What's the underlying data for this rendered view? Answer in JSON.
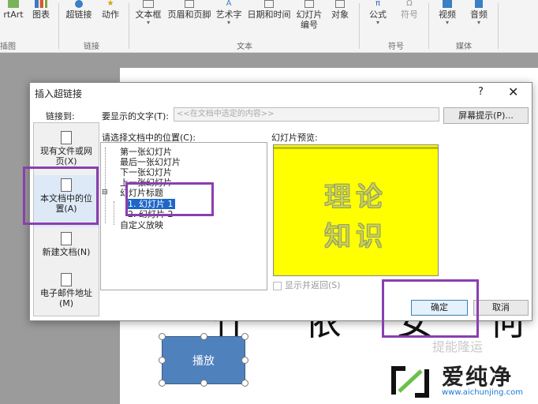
{
  "ribbon": {
    "buttons": {
      "smartart": "rtArt",
      "chart": "图表",
      "hyperlink": "超链接",
      "action": "动作",
      "textbox": "文本框",
      "header_footer": "页眉和页脚",
      "wordart": "艺术字",
      "datetime": "日期和时间",
      "slide_number_1": "幻灯片",
      "slide_number_2": "编号",
      "object": "对象",
      "equation": "公式",
      "symbol": "符号",
      "video": "视频",
      "audio": "音频"
    },
    "groups": {
      "illustrations": "插图",
      "links": "链接",
      "text": "文本",
      "symbols": "符号",
      "media": "媒体"
    }
  },
  "dialog": {
    "title": "插入超链接",
    "help": "?",
    "close": "✕",
    "link_to_label": "链接到:",
    "display_text_label": "要显示的文字(T):",
    "display_text_value": "<<在文档中选定的内容>>",
    "screentip_button": "屏幕提示(P)...",
    "link_bar": {
      "existing_file_1": "现有文件或网",
      "existing_file_2": "页(X)",
      "this_doc_1": "本文档中的位",
      "this_doc_2": "置(A)",
      "new_doc": "新建文档(N)",
      "email_1": "电子邮件地址",
      "email_2": "(M)"
    },
    "place_label": "请选择文档中的位置(C):",
    "tree": {
      "first": "第一张幻灯片",
      "last": "最后一张幻灯片",
      "next": "下一张幻灯片",
      "prev": "上一张幻灯片",
      "slide_titles": "幻灯片标题",
      "slide1": "1. 幻灯片 1",
      "slide2": "2. 幻灯片 2",
      "custom_shows": "自定义放映"
    },
    "preview_label": "幻灯片预览:",
    "preview_line1": "理论",
    "preview_line2": "知识",
    "show_and_return": "显示并返回(S)",
    "ok": "确定",
    "cancel": "取消"
  },
  "slide": {
    "big_text": "什 依 女 何",
    "play_button": "播放",
    "watermark": "提能隆运"
  },
  "logo": {
    "name": "爱纯净",
    "url": "www.aichunjing.com"
  },
  "colors": {
    "annotation": "#8a3fb0",
    "preview_bg": "#ffff00",
    "selection": "#1e66c7",
    "shape_fill": "#4f81bd"
  }
}
